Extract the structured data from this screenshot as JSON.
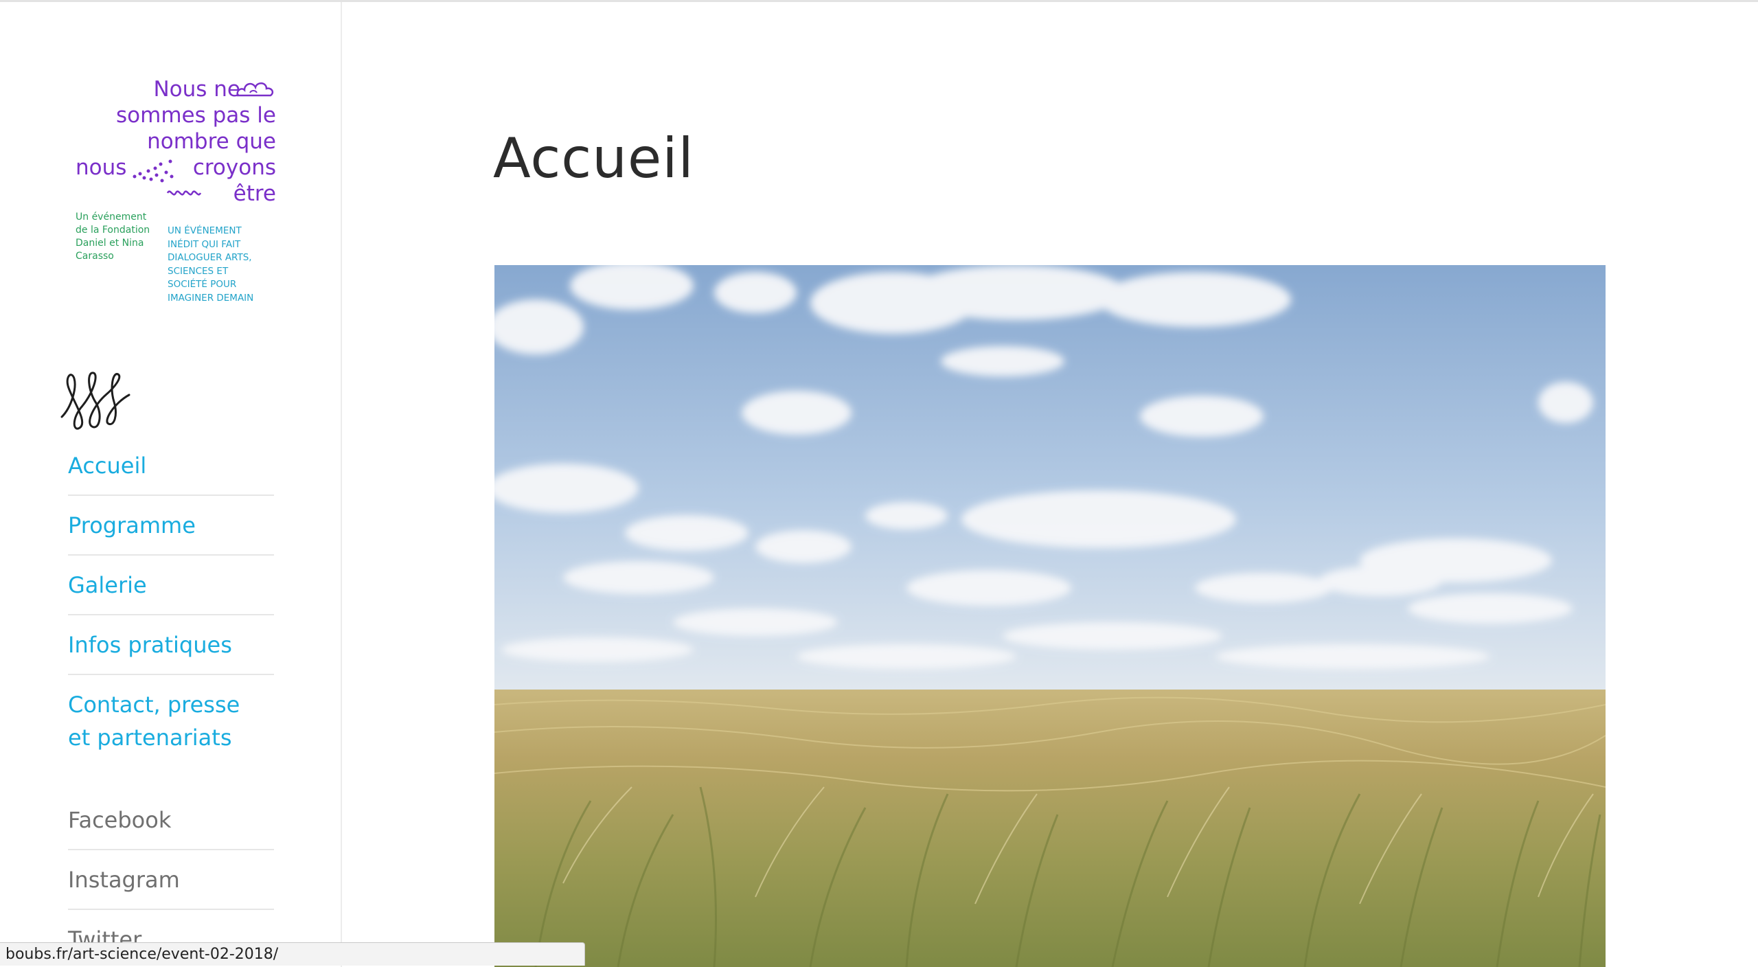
{
  "logo": {
    "lines": [
      "Nous ne",
      "sommes pas le",
      "nombre que",
      "nous",
      "croyons",
      "être"
    ],
    "tagline_left": "Un événement\nde la Fondation\nDaniel et Nina\nCarasso",
    "tagline_right": "UN ÉVÉNEMENT\nINÉDIT QUI FAIT\nDIALOGUER ARTS,\nSCIENCES ET\nSOCIÉTÉ POUR\nIMAGINER DEMAIN"
  },
  "nav": {
    "items": [
      {
        "label": "Accueil"
      },
      {
        "label": "Programme"
      },
      {
        "label": "Galerie"
      },
      {
        "label": "Infos pratiques"
      },
      {
        "label": "Contact, presse et partenariats"
      }
    ]
  },
  "social": {
    "items": [
      {
        "label": "Facebook"
      },
      {
        "label": "Instagram"
      },
      {
        "label": "Twitter"
      }
    ]
  },
  "main": {
    "title": "Accueil"
  },
  "status_bar": {
    "url": "boubs.fr/art-science/event-02-2018/"
  },
  "colors": {
    "nav_link": "#19acdf",
    "social_link": "#707070",
    "logo_purple": "#7a2fc9",
    "logo_green": "#2aa05c",
    "logo_cyan": "#22a3c9",
    "title": "#2c2c2c"
  }
}
